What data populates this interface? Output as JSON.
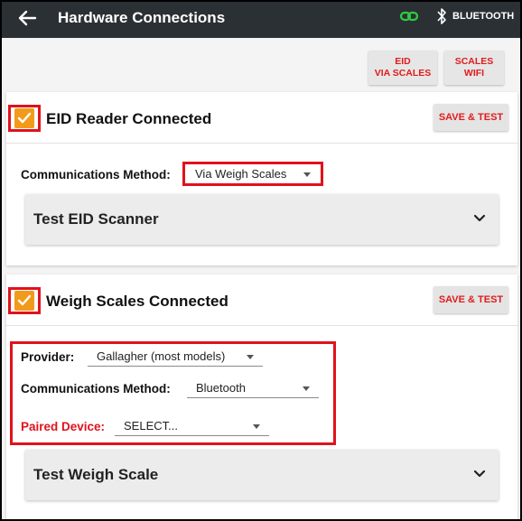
{
  "appbar": {
    "title": "Hardware Connections",
    "bluetooth_label": "BLUETOOTH",
    "link_color": "#2ecc40"
  },
  "top_buttons": {
    "eid_via_scales": [
      "EID",
      "VIA SCALES"
    ],
    "scales_wifi": [
      "SCALES",
      "WIFI"
    ]
  },
  "eid_card": {
    "checked": true,
    "title": "EID Reader Connected",
    "save_label": "SAVE & TEST",
    "comm_label": "Communications Method:",
    "comm_value": "Via Weigh Scales",
    "expander_title": "Test EID Scanner"
  },
  "scales_card": {
    "checked": true,
    "title": "Weigh Scales Connected",
    "save_label": "SAVE & TEST",
    "provider_label": "Provider:",
    "provider_value": "Gallagher (most models)",
    "comm_label": "Communications Method:",
    "comm_value": "Bluetooth",
    "paired_label": "Paired Device:",
    "paired_value": "SELECT...",
    "expander_title": "Test Weigh Scale"
  },
  "colors": {
    "accent_red": "#e0121b",
    "checkbox_orange": "#f29b1b",
    "appbar": "#2b3035"
  }
}
